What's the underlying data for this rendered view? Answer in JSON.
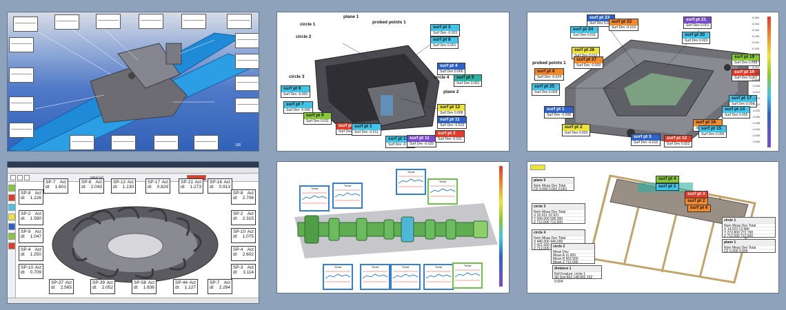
{
  "panel1": {
    "scale_label": "100"
  },
  "panel2": {
    "tags": [
      {
        "head": "plane 1",
        "style": "t-plain"
      },
      {
        "head": "circle 1",
        "style": "t-plain"
      },
      {
        "head": "probed points 1",
        "style": "t-plain"
      },
      {
        "head": "circle 2",
        "style": "t-plain"
      },
      {
        "head": "circle 3",
        "style": "t-plain"
      },
      {
        "head": "circle 4",
        "style": "t-plain"
      },
      {
        "head": "plane 2",
        "style": "t-plain"
      },
      {
        "head": "surf pt 3",
        "sub": "Surf Dev -0.003"
      },
      {
        "head": "surf pt 8",
        "sub": "Surf Dev 0.001"
      },
      {
        "head": "surf pt 4",
        "sub": "Surf Dev 0.006"
      },
      {
        "head": "surf pt 5",
        "sub": "Surf Dev 0.001"
      },
      {
        "head": "surf pt 6",
        "sub": "Surf Dev -0.005"
      },
      {
        "head": "surf pt 7",
        "sub": "Surf Dev -0.005"
      },
      {
        "head": "surf pt 9",
        "sub": "Surf Dev 0.011"
      },
      {
        "head": "surf pt 10",
        "sub": "Surf Dev -0.003"
      },
      {
        "head": "surf pt 1",
        "sub": "Surf Dev -0.011"
      },
      {
        "head": "surf pt 12",
        "sub": "Surf Dev 0.008"
      },
      {
        "head": "surf pt 11",
        "sub": "Surf Dev -0.019"
      },
      {
        "head": "surf pt 13",
        "sub": "Surf Dev -0.021"
      },
      {
        "head": "surf pt 11",
        "sub": "Surf Dev -0.025"
      },
      {
        "head": "surf pt 2",
        "sub": "Surf Dev -0.021"
      }
    ]
  },
  "panel3": {
    "tags": [
      {
        "head": "surf pt 23",
        "sub": "Surf Dev 0.008"
      },
      {
        "head": "surf pt 22",
        "sub": "Surf Dev -0.019"
      },
      {
        "head": "surf pt 21",
        "sub": "Surf Dev 0.001"
      },
      {
        "head": "surf pt 24",
        "sub": "Surf Dev 0.011"
      },
      {
        "head": "surf pt 26",
        "sub": "Surf Dev 0.010"
      },
      {
        "head": "surf pt 27",
        "sub": "Surf Dev -0.009"
      },
      {
        "head": "surf pt 20",
        "sub": "Surf Dev 0.003"
      },
      {
        "head": "surf pt 19",
        "sub": "Surf Dev 0.018"
      },
      {
        "head": "surf pt 18",
        "sub": "Surf Dev 0.007"
      },
      {
        "head": "probed points 1",
        "sub": ""
      },
      {
        "head": "surf pt 6",
        "sub": "Surf Dev -0.024"
      },
      {
        "head": "surf pt 25",
        "sub": "Surf Dev 0.009"
      },
      {
        "head": "surf pt 17",
        "sub": "Surf Dev 0.004"
      },
      {
        "head": "surf pt 14",
        "sub": "Surf Dev 0.005"
      },
      {
        "head": "surf pt 1",
        "sub": "Surf Dev -0.008"
      },
      {
        "head": "surf pt 16",
        "sub": "Surf Dev -0.006"
      },
      {
        "head": "surf pt 2",
        "sub": "Surf Dev 0.003"
      },
      {
        "head": "surf pt 15",
        "sub": "Surf Dev 0.006"
      },
      {
        "head": "surf pt 3",
        "sub": "Surf Dev -0.018"
      },
      {
        "head": "surf pt 12",
        "sub": "Surf Dev 0.022"
      }
    ],
    "scale": [
      "0.050",
      "0.045",
      "0.040",
      "0.035",
      "0.030",
      "0.025",
      "0.020",
      "0.015",
      "0.010",
      "0.005",
      "0.000",
      "-0.005",
      "-0.010",
      "-0.015",
      "-0.020",
      "-0.025",
      "-0.030",
      "-0.035",
      "-0.040",
      "-0.045",
      "-0.050"
    ]
  },
  "panel4": {
    "tab_title": "Metal turf",
    "sp_boxes": [
      {
        "name": "SP-8",
        "act": "Act",
        "dl": "dl:",
        "val": "1.226"
      },
      {
        "name": "SP-7",
        "act": "Act",
        "dl": "dl:",
        "val": "1.601"
      },
      {
        "name": "SP-6",
        "act": "Act",
        "dl": "dl:",
        "val": "2.043"
      },
      {
        "name": "SP-12",
        "act": "Act",
        "dl": "dl:",
        "val": "1.130"
      },
      {
        "name": "SP-17",
        "act": "Act",
        "dl": "dl:",
        "val": "0.829"
      },
      {
        "name": "SP-21",
        "act": "Act",
        "dl": "dl:",
        "val": "1.273"
      },
      {
        "name": "SP-16",
        "act": "Act",
        "dl": "dl:",
        "val": "0.913"
      },
      {
        "name": "SP-8",
        "act": "Act",
        "dl": "dl:",
        "val": "2.706"
      },
      {
        "name": "SP-2",
        "act": "Act",
        "dl": "dl:",
        "val": "1.590"
      },
      {
        "name": "SP-2",
        "act": "Act",
        "dl": "dl:",
        "val": "2.315"
      },
      {
        "name": "SP-9",
        "act": "Act",
        "dl": "dl:",
        "val": "1.047"
      },
      {
        "name": "SP-10",
        "act": "Act",
        "dl": "dl:",
        "val": "1.075"
      },
      {
        "name": "SP-4",
        "act": "Act",
        "dl": "dl:",
        "val": "1.250"
      },
      {
        "name": "SP-4",
        "act": "Act",
        "dl": "dl:",
        "val": "2.602"
      },
      {
        "name": "SP-10",
        "act": "Act",
        "dl": "dl:",
        "val": "0.709"
      },
      {
        "name": "SP-3",
        "act": "Act",
        "dl": "dl:",
        "val": "3.114"
      },
      {
        "name": "SP-37",
        "act": "Act",
        "dl": "dl:",
        "val": "2.565"
      },
      {
        "name": "SP-39",
        "act": "Act",
        "dl": "dl:",
        "val": "2.052"
      },
      {
        "name": "SP-58",
        "act": "Act",
        "dl": "dl:",
        "val": "1.836"
      },
      {
        "name": "SP-44",
        "act": "Act",
        "dl": "dl:",
        "val": "1.127"
      },
      {
        "name": "SP-7",
        "act": "Act",
        "dl": "dl:",
        "val": "2.284"
      }
    ]
  },
  "panel5": {
    "trend_label": "Trend",
    "trends": [
      {
        "style": "blue"
      },
      {
        "style": "blue"
      },
      {
        "style": "blue"
      },
      {
        "style": "green"
      },
      {
        "style": "blue"
      },
      {
        "style": "blue"
      },
      {
        "style": "blue"
      },
      {
        "style": "blue"
      },
      {
        "style": "green"
      }
    ]
  },
  "panel6": {
    "tags": [
      {
        "head": "surf pt 4",
        "style": "t-green"
      },
      {
        "head": "surf pt 1",
        "style": "t-cyan"
      },
      {
        "head": "surf pt 3",
        "style": "t-red"
      },
      {
        "head": "surf pt 2",
        "style": "t-orange"
      },
      {
        "head": "surf pt 6",
        "style": "t-orange"
      }
    ],
    "stats": [
      {
        "title": "plane 5",
        "header": "Nom   Meas   Dev Total",
        "rows": [
          "CF   0.000  0.001  0.001"
        ]
      },
      {
        "title": "circle 3",
        "header": "Nom   Meas   Dev Total",
        "rows": [
          "X   32.921   32.921",
          "Y   695.000  695.000",
          "Z   712.000  712.000"
        ]
      },
      {
        "title": "circle 4",
        "header": "Nom   Meas   Dev Total",
        "rows": [
          "X   440.000  440.000",
          "Y   421.930  421.930",
          "Z   712.000  712.000"
        ]
      },
      {
        "title": "circle 1",
        "header": "Nom   Meas   Dev Total",
        "rows": [
          "X   14.023   13.980",
          "Y   272.800  272.790",
          "Z   712.000  712.000"
        ]
      },
      {
        "title": "circle 2",
        "header": "Mean Dev",
        "rows": [
          "Mean A  11.000",
          "Mean B  502.000",
          "Mean Z  712.000"
        ]
      },
      {
        "title": "plane 1",
        "header": "Nom   Meas   Dev Total",
        "rows": [
          "CF   0.000  0.005"
        ]
      },
      {
        "title": "distance 1",
        "header": "Ref Feature: circle 1",
        "rows": [
          "3D Dist  802.148  802.152  0.004"
        ]
      }
    ]
  }
}
